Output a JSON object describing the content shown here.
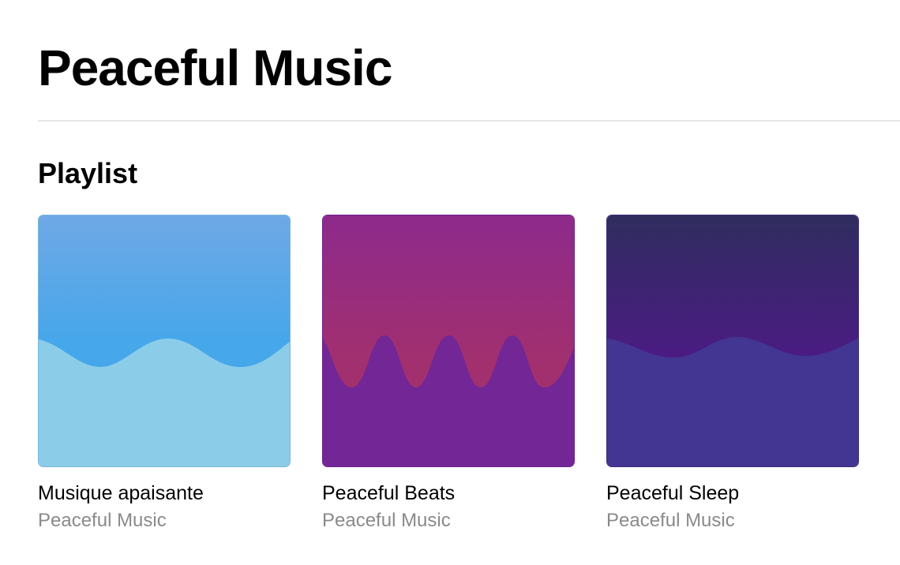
{
  "header": {
    "title": "Peaceful Music"
  },
  "section": {
    "title": "Playlist"
  },
  "playlists": [
    {
      "title": "Musique apaisante",
      "subtitle": "Peaceful Music",
      "artwork": {
        "sky_top": "#6fa8e6",
        "sky_bottom": "#46a7ea",
        "wave": "#8bcde9",
        "border": "#7cb6d6",
        "style": "gentle-wave"
      }
    },
    {
      "title": "Peaceful Beats",
      "subtitle": "Peaceful Music",
      "artwork": {
        "sky_top": "#8e2a8c",
        "sky_bottom": "#a2306e",
        "wave": "#732696",
        "border": "#6a2288",
        "style": "pulse-wave"
      }
    },
    {
      "title": "Peaceful Sleep",
      "subtitle": "Peaceful Music",
      "artwork": {
        "sky_top": "#2f2d5f",
        "sky_bottom": "#4a1c82",
        "wave": "#433592",
        "border": "#3b2f7a",
        "style": "calm-wave"
      }
    }
  ]
}
